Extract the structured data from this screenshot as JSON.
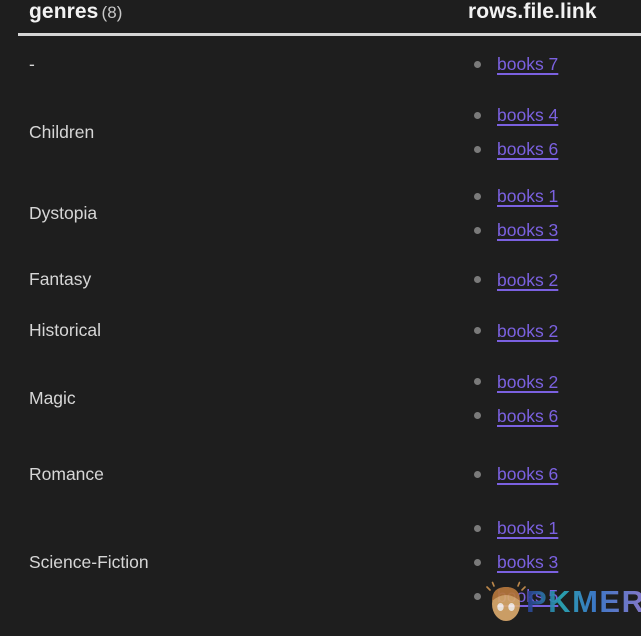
{
  "table": {
    "columns": [
      {
        "key": "genres",
        "label": "genres",
        "count": "(8)"
      },
      {
        "key": "links",
        "label": "rows.file.link"
      }
    ],
    "rows": [
      {
        "genre": "-",
        "links": [
          {
            "label": "books 7"
          }
        ]
      },
      {
        "genre": "Children",
        "links": [
          {
            "label": "books 4"
          },
          {
            "label": "books 6"
          }
        ]
      },
      {
        "genre": "Dystopia",
        "links": [
          {
            "label": "books 1"
          },
          {
            "label": "books 3"
          }
        ]
      },
      {
        "genre": "Fantasy",
        "links": [
          {
            "label": "books 2"
          }
        ]
      },
      {
        "genre": "Historical",
        "links": [
          {
            "label": "books 2"
          }
        ]
      },
      {
        "genre": "Magic",
        "links": [
          {
            "label": "books 2"
          },
          {
            "label": "books 6"
          }
        ]
      },
      {
        "genre": "Romance",
        "links": [
          {
            "label": "books 6"
          }
        ]
      },
      {
        "genre": "Science-Fiction",
        "links": [
          {
            "label": "books 1"
          },
          {
            "label": "books 3"
          },
          {
            "label": "books 5"
          }
        ]
      }
    ]
  },
  "watermark": {
    "text": "PKMER",
    "logo_icon": "egg-mascot-icon"
  },
  "colors": {
    "background": "#1e1e1e",
    "header_text": "#f2f2f2",
    "header_count": "#c7c7c7",
    "body_text": "#d6d6d6",
    "link": "#7b61e0",
    "bullet": "#7a7a7a",
    "header_rule": "#d4d4d4"
  }
}
